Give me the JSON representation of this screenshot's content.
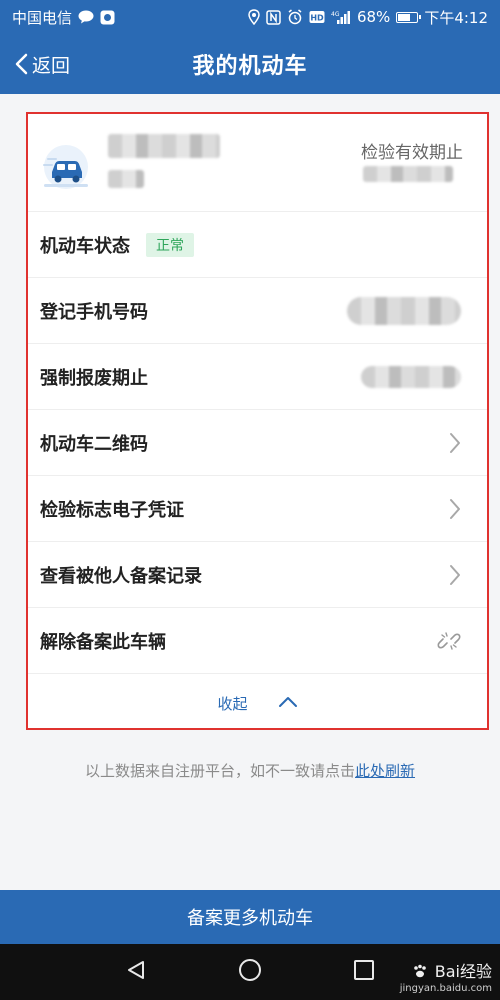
{
  "status_bar": {
    "carrier": "中国电信",
    "battery": "68%",
    "battery_level": 0.68,
    "time": "下午4:12"
  },
  "header": {
    "back_label": "返回",
    "title": "我的机动车"
  },
  "vehicle": {
    "expiry_label": "检验有效期止"
  },
  "rows": {
    "status": {
      "label": "机动车状态",
      "badge": "正常"
    },
    "phone": {
      "label": "登记手机号码"
    },
    "scrap": {
      "label": "强制报废期止"
    },
    "qrcode": {
      "label": "机动车二维码"
    },
    "certificate": {
      "label": "检验标志电子凭证"
    },
    "records": {
      "label": "查看被他人备案记录"
    },
    "remove": {
      "label": "解除备案此车辆"
    }
  },
  "collapse_label": "收起",
  "note": {
    "text": "以上数据来自注册平台，如不一致请点击",
    "link": "此处刷新"
  },
  "primary_button": "备案更多机动车",
  "watermark": {
    "brand": "Bai经验",
    "domain": "jingyan.baidu.com"
  },
  "colors": {
    "primary": "#2a6ab4",
    "highlight_border": "#e0322f",
    "status_ok": "#2ea55a"
  },
  "icons": [
    "wechat-icon",
    "app-icon",
    "location-icon",
    "nfc-icon",
    "alarm-icon",
    "hd-icon",
    "signal-icon",
    "battery-icon",
    "back-chevron-icon",
    "car-icon",
    "chevron-right-icon",
    "unlink-icon",
    "chevron-up-icon",
    "nav-back-icon",
    "nav-home-icon",
    "nav-recent-icon",
    "paw-icon"
  ]
}
